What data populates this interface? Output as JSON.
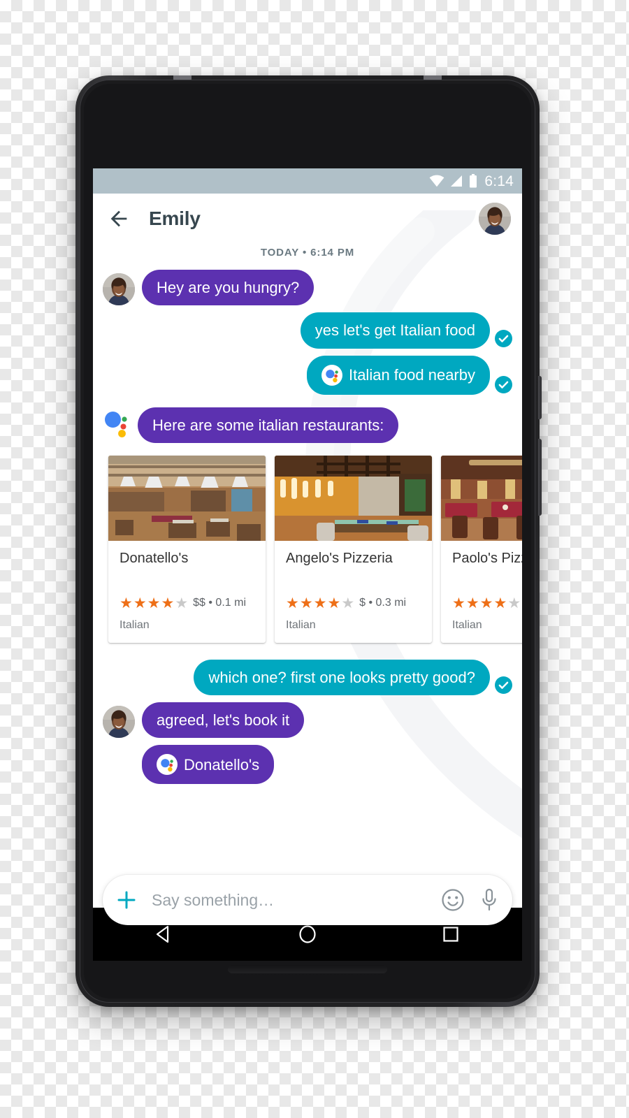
{
  "device": {
    "name": "android-phone"
  },
  "status_bar": {
    "time": "6:14",
    "icons": [
      "wifi-icon",
      "cell-signal-icon",
      "battery-icon"
    ],
    "background_color": "#b0c0c8"
  },
  "header": {
    "back_icon": "back-arrow-icon",
    "title": "Emily",
    "avatar": "contact-avatar"
  },
  "day_divider": "TODAY • 6:14 PM",
  "colors": {
    "incoming_bubble": "#5c31b0",
    "outgoing_bubble": "#00a8c0",
    "title_text": "#37474f",
    "star_active": "#ee6f17",
    "star_inactive": "#c9c9c9",
    "accent_plus": "#00a8c0"
  },
  "messages": [
    {
      "id": "m1",
      "side": "in",
      "sender": "Emily",
      "text": "Hey are you hungry?",
      "avatar": true,
      "assistant_chip": false,
      "delivered": false
    },
    {
      "id": "m2",
      "side": "out",
      "sender": "You",
      "text": "yes let's get Italian food",
      "avatar": false,
      "assistant_chip": false,
      "delivered": true
    },
    {
      "id": "m3",
      "side": "out",
      "sender": "You",
      "text": "Italian food nearby",
      "avatar": false,
      "assistant_chip": true,
      "delivered": true
    },
    {
      "id": "m4",
      "side": "in",
      "sender": "Assistant",
      "text": "Here are some italian restaurants:",
      "avatar": false,
      "assistant_chip": false,
      "delivered": false,
      "assistant_logo": true
    },
    {
      "id": "m5",
      "side": "out",
      "sender": "You",
      "text": "which one? first one looks pretty good?",
      "avatar": false,
      "assistant_chip": false,
      "delivered": true
    },
    {
      "id": "m6",
      "side": "in",
      "sender": "Emily",
      "text": "agreed, let's book it",
      "avatar": true,
      "assistant_chip": false,
      "delivered": false
    },
    {
      "id": "m7",
      "side": "in",
      "sender": "Emily",
      "text": "Donatello's",
      "avatar": false,
      "assistant_chip": true,
      "delivered": false
    }
  ],
  "restaurant_cards": [
    {
      "name": "Donatello's",
      "rating": 4,
      "max_rating": 5,
      "price": "$$",
      "distance": "0.1 mi",
      "meta": "$$ • 0.1 mi",
      "cuisine": "Italian",
      "image": "restaurant-interior-industrial"
    },
    {
      "name": "Angelo's Pizzeria",
      "rating": 4,
      "max_rating": 5,
      "price": "$",
      "distance": "0.3 mi",
      "meta": "$ • 0.3 mi",
      "cuisine": "Italian",
      "image": "restaurant-interior-warm"
    },
    {
      "name": "Paolo's Pizzeria",
      "rating": 4,
      "max_rating": 5,
      "price": "",
      "distance": "",
      "meta": "",
      "cuisine": "Italian",
      "image": "restaurant-interior-red"
    }
  ],
  "composer": {
    "plus_icon": "plus-icon",
    "placeholder": "Say something…",
    "value": "",
    "emoji_icon": "emoji-icon",
    "mic_icon": "mic-icon"
  },
  "nav_bar": {
    "back": "nav-back-triangle-icon",
    "home": "nav-home-circle-icon",
    "recents": "nav-recents-square-icon"
  }
}
